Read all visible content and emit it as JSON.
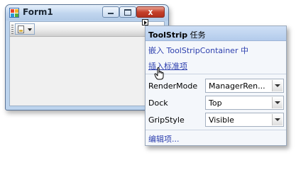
{
  "form": {
    "title": "Form1",
    "close_glyph": "x",
    "icons": {
      "app": "form-app-icon",
      "minimize": "minimize-icon",
      "maximize": "maximize-icon",
      "close": "close-icon"
    }
  },
  "toolstrip": {
    "dropdown_icon": "image-icon",
    "smart_tag_icon": "smart-tag-arrow-icon"
  },
  "panel": {
    "title_bold": "ToolStrip",
    "title_rest": " 任务",
    "embed_link": "嵌入 ToolStripContainer 中",
    "insert_link": "插入标准项",
    "properties": [
      {
        "label": "RenderMode",
        "value": "ManagerRen..."
      },
      {
        "label": "Dock",
        "value": "Top"
      },
      {
        "label": "GripStyle",
        "value": "Visible"
      }
    ],
    "edit_items_link": "编辑项..."
  },
  "colors": {
    "link": "#2c3fae",
    "panel_header": "#c3d7f1",
    "window_frame": "#bcd3ed",
    "close_button": "#c5402a"
  }
}
